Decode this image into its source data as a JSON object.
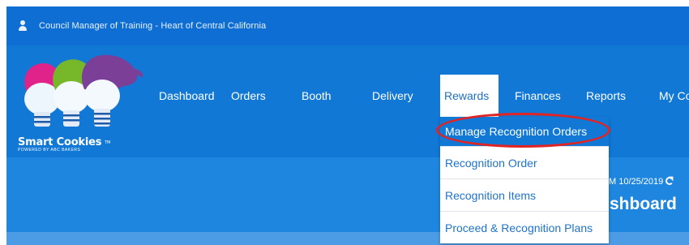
{
  "header": {
    "user_title": "Council Manager of Training - Heart of Central California"
  },
  "logo": {
    "brand": "Smart Cookies",
    "tm": "TM",
    "tagline": "POWERED BY ABC BAKERS"
  },
  "nav": {
    "items": [
      {
        "label": "Dashboard"
      },
      {
        "label": "Orders"
      },
      {
        "label": "Booth"
      },
      {
        "label": "Delivery"
      },
      {
        "label": "Rewards",
        "active": true
      },
      {
        "label": "Finances"
      },
      {
        "label": "Reports"
      },
      {
        "label": "My Co"
      }
    ]
  },
  "rewards_menu": {
    "items": [
      {
        "label": "Manage Recognition Orders"
      },
      {
        "label": "Recognition Order"
      },
      {
        "label": "Recognition Items"
      },
      {
        "label": "Proceed & Recognition Plans"
      }
    ]
  },
  "page": {
    "as_of": "M 10/25/2019",
    "heading": "shboard"
  },
  "colors": {
    "topbar": "#0f6ed4",
    "navbar": "#1178d6",
    "content": "#1f86e0",
    "highlight_ring": "#e02424",
    "menu_text": "#1f73c7"
  }
}
